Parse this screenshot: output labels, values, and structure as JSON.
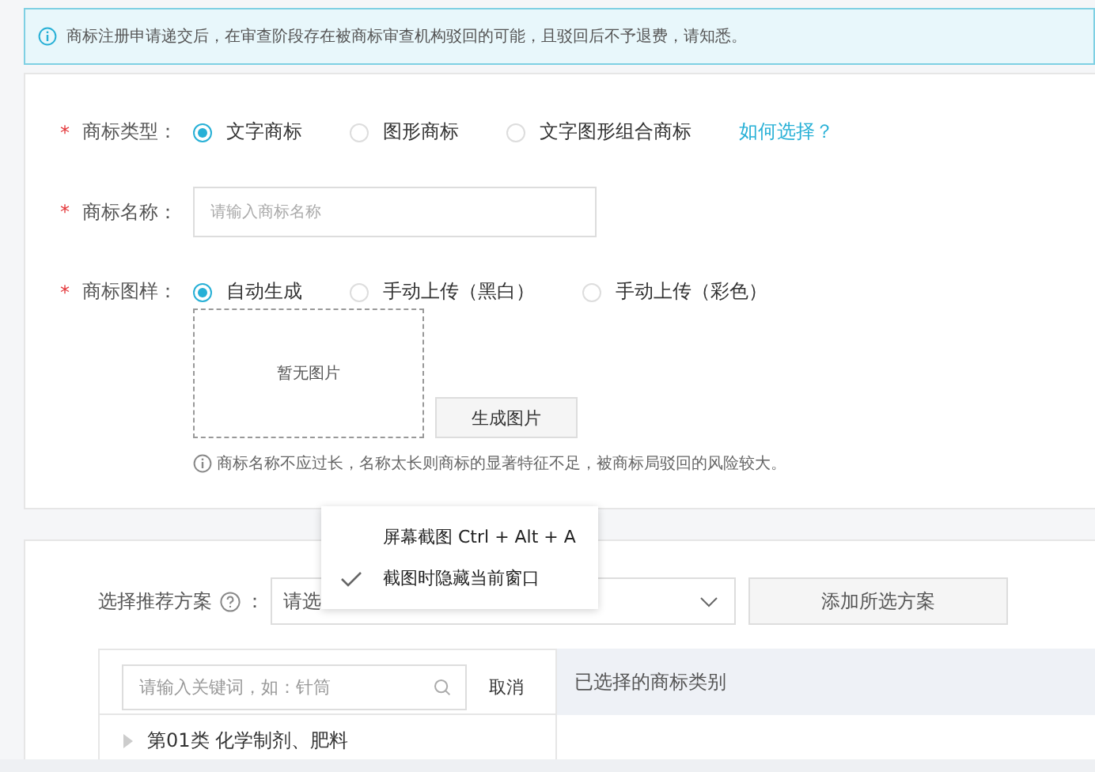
{
  "notice": {
    "text": "商标注册申请递交后，在审查阶段存在被商标审查机构驳回的可能，且驳回后不予退费，请知悉。"
  },
  "form": {
    "type_field": {
      "label": "商标类型：",
      "required_mark": "*",
      "options": [
        {
          "label": "文字商标",
          "selected": true
        },
        {
          "label": "图形商标",
          "selected": false
        },
        {
          "label": "文字图形组合商标",
          "selected": false
        }
      ],
      "help_link": "如何选择？"
    },
    "name_field": {
      "label": "商标名称：",
      "required_mark": "*",
      "placeholder": "请输入商标名称"
    },
    "image_field": {
      "label": "商标图样：",
      "required_mark": "*",
      "options": [
        {
          "label": "自动生成",
          "selected": true
        },
        {
          "label": "手动上传（黑白）",
          "selected": false
        },
        {
          "label": "手动上传（彩色）",
          "selected": false
        }
      ],
      "preview_text": "暂无图片",
      "generate_button": "生成图片",
      "hint": "商标名称不应过长，名称太长则商标的显著特征不足，被商标局驳回的风险较大。"
    }
  },
  "plan": {
    "label": "选择推荐方案",
    "colon": "：",
    "select_value": "请选",
    "add_button": "添加所选方案",
    "search": {
      "placeholder": "请输入关键词，如：针筒",
      "cancel": "取消"
    },
    "categories": [
      {
        "label": "第01类 化学制剂、肥料",
        "expanded": false
      }
    ],
    "selected_header": "已选择的商标类别"
  },
  "context_menu": {
    "items": [
      {
        "label": "屏幕截图 Ctrl + Alt + A",
        "checked": false
      },
      {
        "label": "截图时隐藏当前窗口",
        "checked": true
      }
    ]
  }
}
